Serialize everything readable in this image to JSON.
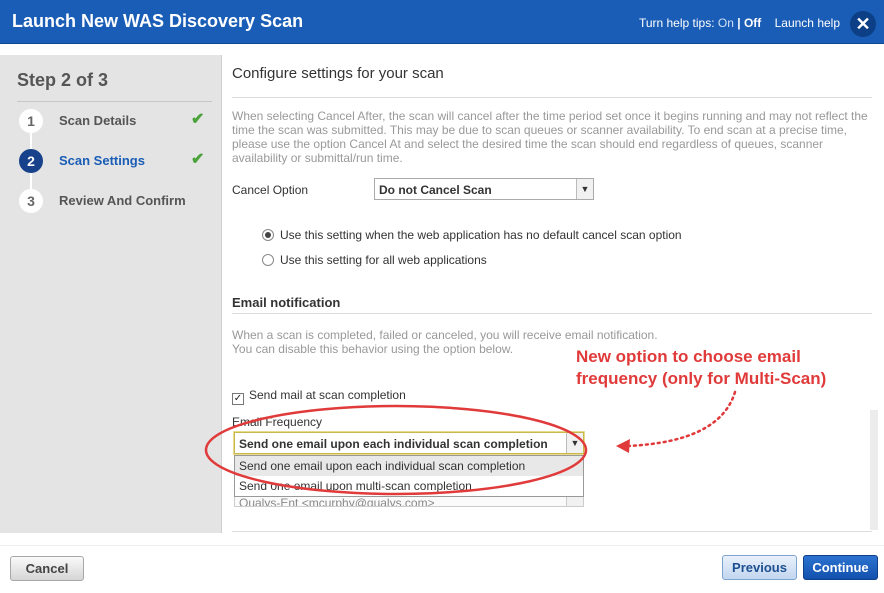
{
  "window": {
    "title": "Launch New WAS Discovery Scan",
    "help_prefix": "Turn help tips:",
    "help_on": "On",
    "help_sep": "|",
    "help_off": "Off",
    "launch_help": "Launch help",
    "close_glyph": "✕"
  },
  "sidebar": {
    "step_heading": "Step 2 of 3",
    "steps": [
      {
        "number": "1",
        "label": "Scan Details",
        "completed": true
      },
      {
        "number": "2",
        "label": "Scan Settings",
        "completed": true
      },
      {
        "number": "3",
        "label": "Review And Confirm",
        "completed": false
      }
    ],
    "check_glyph": "✔"
  },
  "main": {
    "title": "Configure settings for your scan",
    "cancel_info": "When selecting Cancel After, the scan will cancel after the time period set once it begins running and may not reflect the time the scan was submitted. This may be due to scan queues or scanner availability. To end scan at a precise time, please use the option Cancel At and select the desired time the scan should end regardless of queues, scanner availability or submittal/run time.",
    "cancel_option_label": "Cancel Option",
    "cancel_option_value": "Do not Cancel Scan",
    "radio_default": "Use this setting when the web application has no default cancel scan option",
    "radio_all": "Use this setting for all web applications",
    "email_heading": "Email notification",
    "email_info_line1": "When a scan is completed, failed or canceled, you will receive email notification.",
    "email_info_line2": "You can disable this behavior using the option below.",
    "send_mail_label": "Send mail at scan completion",
    "send_mail_checked": true,
    "email_frequency_label": "Email Frequency",
    "email_frequency_value": "Send one email upon each individual scan completion",
    "email_frequency_options": [
      "Send one email upon each individual scan completion",
      "Send one email upon multi-scan completion"
    ],
    "partially_hidden_value": "Qualys-Ent <mcurphy@qualys.com>",
    "dropdown_arrow": "▼"
  },
  "annotation": {
    "line1": "New option to choose email",
    "line2": "frequency (only for Multi-Scan)",
    "color": "#e03a3a"
  },
  "footer": {
    "cancel": "Cancel",
    "previous": "Previous",
    "continue": "Continue"
  }
}
